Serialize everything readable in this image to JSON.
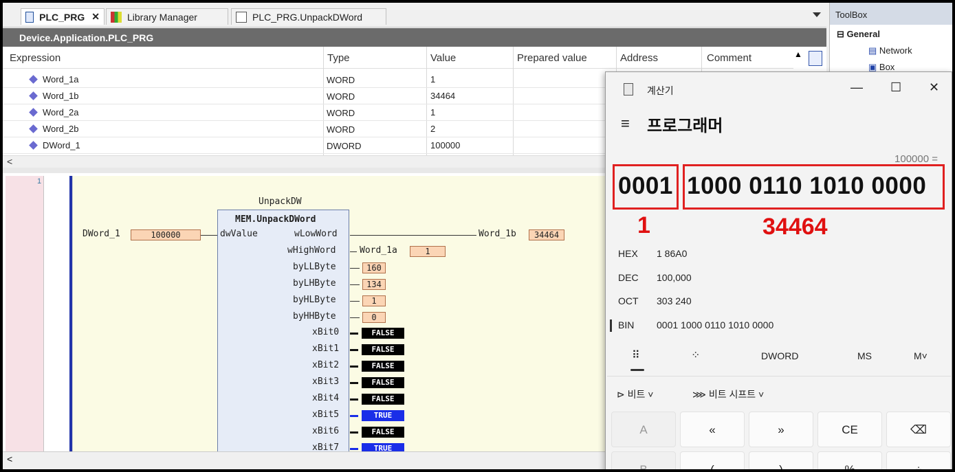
{
  "tabs": [
    {
      "label": "PLC_PRG",
      "active": true
    },
    {
      "label": "Library Manager",
      "active": false
    },
    {
      "label": "PLC_PRG.UnpackDWord",
      "active": false
    }
  ],
  "path": "Device.Application.PLC_PRG",
  "watch": {
    "columns": [
      "Expression",
      "Type",
      "Value",
      "Prepared value",
      "Address",
      "Comment"
    ],
    "rows": [
      {
        "name": "Word_1a",
        "type": "WORD",
        "value": "1"
      },
      {
        "name": "Word_1b",
        "type": "WORD",
        "value": "34464"
      },
      {
        "name": "Word_2a",
        "type": "WORD",
        "value": "1"
      },
      {
        "name": "Word_2b",
        "type": "WORD",
        "value": "2"
      },
      {
        "name": "DWord_1",
        "type": "DWORD",
        "value": "100000"
      }
    ]
  },
  "fbd": {
    "line_number": "1",
    "instance": "UnpackDW",
    "block_type": "MEM.UnpackDWord",
    "input_var": "DWord_1",
    "input_value": "100000",
    "input_pin": "dwValue",
    "outputs": {
      "wLowWord": {
        "pin": "wLowWord",
        "var": "Word_1b",
        "value": "34464"
      },
      "wHighWord": {
        "pin": "wHighWord",
        "var": "Word_1a",
        "value": "1"
      },
      "byLLByte": {
        "pin": "byLLByte",
        "value": "160"
      },
      "byLHByte": {
        "pin": "byLHByte",
        "value": "134"
      },
      "byHLByte": {
        "pin": "byHLByte",
        "value": "1"
      },
      "byHHByte": {
        "pin": "byHHByte",
        "value": "0"
      }
    },
    "bits": [
      {
        "pin": "xBit0",
        "value": "FALSE"
      },
      {
        "pin": "xBit1",
        "value": "FALSE"
      },
      {
        "pin": "xBit2",
        "value": "FALSE"
      },
      {
        "pin": "xBit3",
        "value": "FALSE"
      },
      {
        "pin": "xBit4",
        "value": "FALSE"
      },
      {
        "pin": "xBit5",
        "value": "TRUE"
      },
      {
        "pin": "xBit6",
        "value": "FALSE"
      },
      {
        "pin": "xBit7",
        "value": "TRUE"
      }
    ]
  },
  "toolbox": {
    "title": "ToolBox",
    "group": "General",
    "items": [
      "Network",
      "Box"
    ]
  },
  "calculator": {
    "title": "계산기",
    "mode": "프로그래머",
    "expression": "100000 =",
    "display_high": "0001",
    "display_low": "1000 0110 1010 0000",
    "annotation_high": "1",
    "annotation_low": "34464",
    "radix": [
      {
        "label": "HEX",
        "value": "1 86A0"
      },
      {
        "label": "DEC",
        "value": "100,000"
      },
      {
        "label": "OCT",
        "value": "303 240"
      },
      {
        "label": "BIN",
        "value": "0001 1000 0110 1010 0000"
      }
    ],
    "word_size": "DWORD",
    "ms": "MS",
    "m_dropdown": "M˅",
    "bitwise": "비트",
    "bitshift": "비트 시프트",
    "keys_row1": [
      "A",
      "«",
      "»",
      "CE",
      "⌫"
    ],
    "keys_row2": [
      "B",
      "(",
      ")",
      "%",
      "÷"
    ]
  },
  "colors": {
    "accent_red": "#e02020",
    "true_blue": "#1a2ee8",
    "value_box": "#fbd5b5"
  }
}
